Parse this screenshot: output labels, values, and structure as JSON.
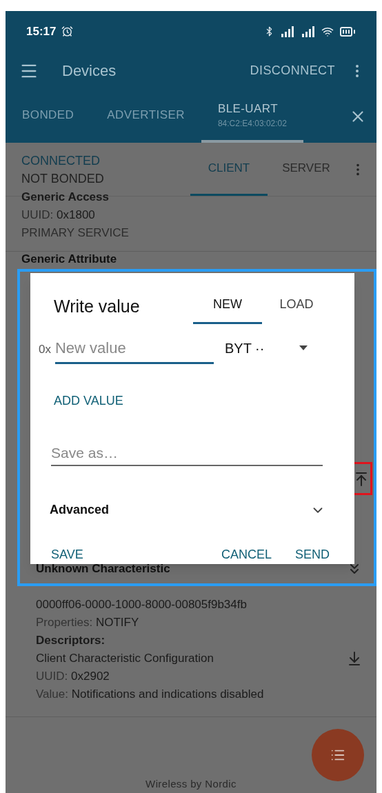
{
  "status_bar": {
    "time": "15:17"
  },
  "toolbar": {
    "title": "Devices",
    "action": "DISCONNECT"
  },
  "device_tabs": [
    {
      "label": "BONDED",
      "selected": false
    },
    {
      "label": "ADVERTISER",
      "selected": false
    },
    {
      "label": "BLE-UART",
      "address": "84:C2:E4:03:02:02",
      "selected": true
    }
  ],
  "connection": {
    "state": "CONNECTED",
    "bond_state": "NOT BONDED"
  },
  "view_tabs": [
    {
      "label": "CLIENT",
      "selected": true
    },
    {
      "label": "SERVER",
      "selected": false
    }
  ],
  "services": [
    {
      "name": "Generic Access",
      "uuid_label": "UUID:",
      "uuid": "0x1800",
      "type": "PRIMARY SERVICE"
    },
    {
      "name": "Generic Attribute"
    }
  ],
  "characteristic": {
    "name": "Unknown Characteristic",
    "uuid": "0000ff06-0000-1000-8000-00805f9b34fb",
    "properties_label": "Properties:",
    "properties": "NOTIFY",
    "descriptors_label": "Descriptors:",
    "descriptor": {
      "name": "Client Characteristic Configuration",
      "uuid_label": "UUID:",
      "uuid": "0x2902",
      "value_label": "Value:",
      "value": "Notifications and indications disabled"
    }
  },
  "dialog": {
    "title": "Write value",
    "tabs": [
      {
        "label": "NEW",
        "selected": true
      },
      {
        "label": "LOAD",
        "selected": false
      }
    ],
    "prefix": "0x",
    "placeholder": "New value",
    "format": "BYT ··",
    "add_label": "ADD VALUE",
    "save_placeholder": "Save as…",
    "advanced": {
      "label": "Advanced",
      "expanded": false
    },
    "buttons": [
      {
        "label": "SAVE"
      },
      {
        "label": "CANCEL"
      },
      {
        "label": "SEND"
      }
    ]
  },
  "footer": "Wireless by Nordic"
}
